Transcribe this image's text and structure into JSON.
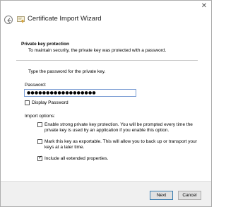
{
  "window": {
    "title": "Certificate Import Wizard",
    "close_glyph": "✕"
  },
  "header": {
    "title": "Private key protection",
    "description": "To maintain security, the private key was protected with a password."
  },
  "body": {
    "prompt": "Type the password for the private key.",
    "password_label": "Password:",
    "password_value": "●●●●●●●●●●●●●●●●●●",
    "display_password_label": "Display Password",
    "display_password_checked": false,
    "import_options_label": "Import options:",
    "options": [
      {
        "line1": "Enable strong private key protection. You will be prompted every time the",
        "line2": "private key is used by an application if you enable this option.",
        "checked": false
      },
      {
        "line1": "Mark this key as exportable. This will allow you to back up or transport your",
        "line2": "keys at a later time.",
        "checked": false
      },
      {
        "line1": "Include all extended properties.",
        "line2": "",
        "checked": true
      }
    ]
  },
  "footer": {
    "next_label": "Next",
    "cancel_label": "Cancel"
  },
  "icons": {
    "back": "back-arrow-icon",
    "title": "certificate-icon",
    "close": "close-icon"
  }
}
